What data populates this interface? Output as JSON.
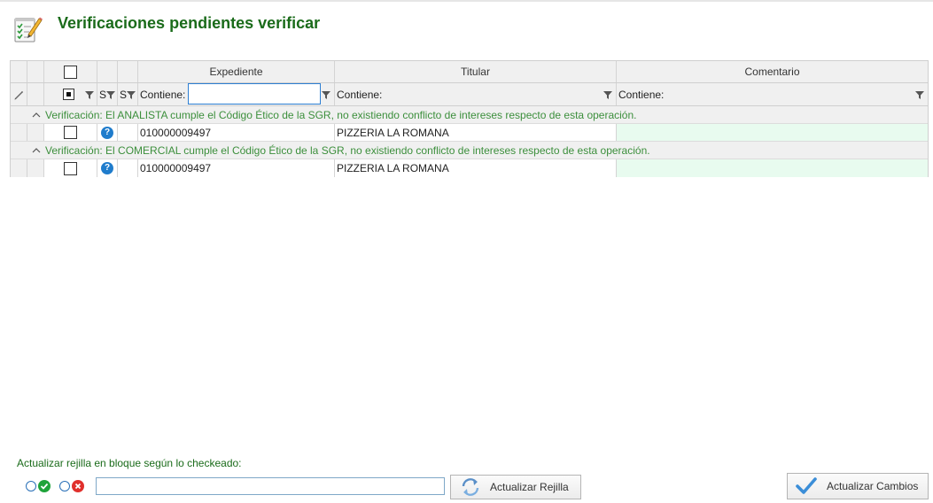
{
  "page": {
    "title": "Verificaciones pendientes verificar",
    "icon": "notepad-pencil-icon"
  },
  "grid": {
    "columns": {
      "expediente": "Expediente",
      "titular": "Titular",
      "comentario": "Comentario",
      "s1": "S",
      "s2": "S"
    },
    "filters": {
      "expediente_label": "Contiene:",
      "expediente_value": "",
      "titular_label": "Contiene:",
      "comentario_label": "Contiene:"
    },
    "groups": [
      {
        "label": "Verificación: El ANALISTA cumple el Código Ético de la SGR, no existiendo conflicto de intereses respecto de esta operación.",
        "rows": [
          {
            "expediente": "010000009497",
            "titular": "PIZZERIA LA ROMANA",
            "comentario": ""
          }
        ]
      },
      {
        "label": "Verificación: El COMERCIAL cumple el Código Ético de la SGR, no existiendo conflicto de intereses respecto de esta operación.",
        "rows": [
          {
            "expediente": "010000009497",
            "titular": "PIZZERIA LA ROMANA",
            "comentario": ""
          }
        ]
      }
    ],
    "help_glyph": "?"
  },
  "bulk": {
    "label": "Actualizar rejilla en bloque según lo checkeado:",
    "input_value": "",
    "refresh_button": "Actualizar Rejilla",
    "save_button": "Actualizar Cambios"
  },
  "colors": {
    "title_green": "#1a6b1a",
    "group_text_green": "#3c8f3c",
    "comment_cell_bg": "#e8fbef",
    "ok_green": "#1fa33a",
    "cancel_red": "#e0302c",
    "help_blue": "#1f7ccc",
    "check_blue": "#3b8ed8"
  }
}
